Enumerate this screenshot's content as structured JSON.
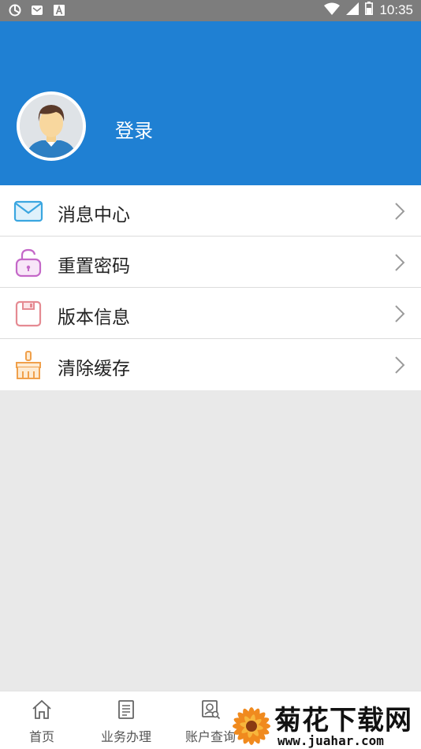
{
  "status_bar": {
    "time": "10:35",
    "icons": [
      "sync-icon",
      "mail-icon",
      "a-icon",
      "wifi-icon",
      "signal-icon",
      "battery-icon"
    ]
  },
  "header": {
    "login_label": "登录",
    "background_color": "#1f80d3"
  },
  "menu": {
    "items": [
      {
        "label": "消息中心",
        "icon": "envelope-icon",
        "color": "#3aa6e0"
      },
      {
        "label": "重置密码",
        "icon": "unlock-icon",
        "color": "#c468c8"
      },
      {
        "label": "版本信息",
        "icon": "save-icon",
        "color": "#e58a92"
      },
      {
        "label": "清除缓存",
        "icon": "broom-icon",
        "color": "#f0a04b"
      }
    ]
  },
  "bottom_nav": {
    "items": [
      {
        "label": "首页",
        "icon": "home-icon"
      },
      {
        "label": "业务办理",
        "icon": "document-icon"
      },
      {
        "label": "账户查询",
        "icon": "account-search-icon"
      }
    ]
  },
  "watermark": {
    "title": "菊花下载网",
    "url": "www.juahar.com"
  }
}
